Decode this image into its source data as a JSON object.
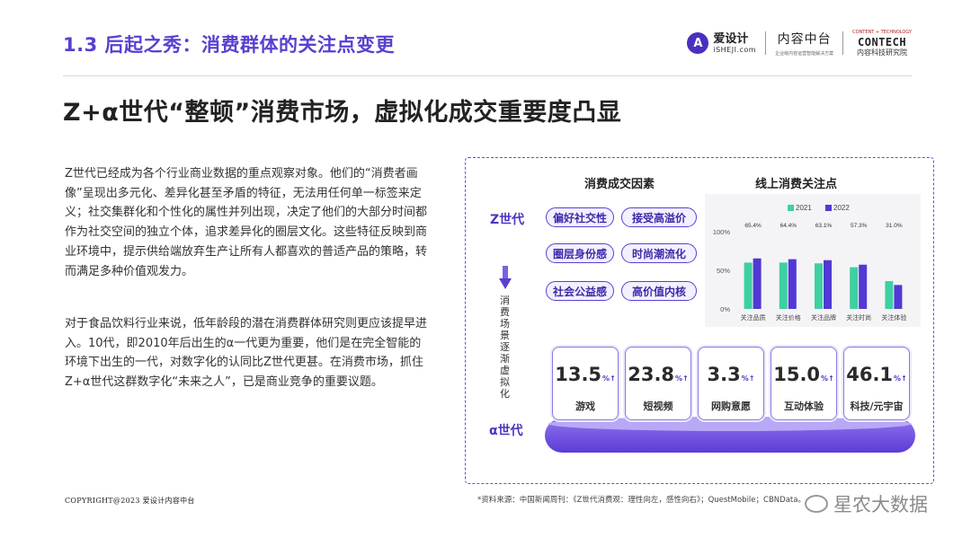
{
  "header": {
    "section_title": "1.3 后起之秀：消费群体的关注点变更",
    "logo_aisheji_main": "爱设计",
    "logo_aisheji_sub": "iSHEJI.com",
    "logo_aisheji_mark": "A",
    "logo_neirong_main": "内容中台",
    "logo_neirong_sub": "企业级内容运营智能解决方案",
    "logo_contech_top": "CONTENT + TECHNOLOGY",
    "logo_contech_main": "CONTECH",
    "logo_contech_sub": "内容科技研究院"
  },
  "main_title": "Z+α世代“整顿”消费市场，虚拟化成交重要度凸显",
  "paragraphs": [
    "Z世代已经成为各个行业商业数据的重点观察对象。他们的“消费者画像”呈现出多元化、差异化甚至矛盾的特征，无法用任何单一标签来定义；社交集群化和个性化的属性并列出现，决定了他们的大部分时间都作为社交空间的独立个体，追求差异化的圈层文化。这些特征反映到商业环境中，提示供给端放弃生产让所有人都喜欢的普适产品的策略，转而满足多种价值观发力。",
    "对于食品饮料行业来说，低年龄段的潜在消费群体研究则更应该提早进入。10代，即2010年后出生的α一代更为重要，他们是在完全智能的环境下出生的一代，对数字化的认同比Z世代更甚。在消费市场，抓住Z+α世代这群数字化“未来之人”，已是商业竞争的重要议题。"
  ],
  "infographic": {
    "heading_left": "消费成交因素",
    "heading_right": "线上消费关注点",
    "gen_z": "Z世代",
    "gen_alpha": "α世代",
    "vertical_text": "消费场景逐渐虚拟化",
    "tags": [
      "偏好社交性",
      "接受高溢价",
      "圈层身份感",
      "时尚潮流化",
      "社会公益感",
      "高价值内核"
    ],
    "colors": {
      "y2021": "#3ecfa3",
      "y2022": "#5238d4",
      "accent": "#5a3fd0"
    },
    "cards": [
      {
        "value": "13.5",
        "unit": "%↑",
        "label": "游戏"
      },
      {
        "value": "23.8",
        "unit": "%↑",
        "label": "短视频"
      },
      {
        "value": "3.3",
        "unit": "%↑",
        "label": "网购意愿"
      },
      {
        "value": "15.0",
        "unit": "%↑",
        "label": "互动体验"
      },
      {
        "value": "46.1",
        "unit": "%↑",
        "label": "科技/元宇宙"
      }
    ]
  },
  "chart_data": {
    "type": "bar",
    "categories": [
      "关注品质",
      "关注价格",
      "关注品牌",
      "关注时尚",
      "关注体验"
    ],
    "series": [
      {
        "name": "2021",
        "values": [
          60,
          60,
          59,
          54,
          36
        ]
      },
      {
        "name": "2022",
        "values": [
          65.4,
          64.4,
          63.1,
          57.3,
          31.0
        ]
      }
    ],
    "data_labels": [
      "65.4%",
      "64.4%",
      "63.1%",
      "57.3%",
      "31.0%"
    ],
    "ylim": [
      0,
      100
    ],
    "yticks": [
      "0%",
      "50%",
      "100%"
    ],
    "legend": "top",
    "grid": false
  },
  "footer": {
    "copyright": "COPYRIGHT@2023  爱设计内容中台",
    "source": "*资料来源：中国新闻周刊：《Z世代消费观：理性向左，感性向右》；QuestMobile；CBNData。",
    "watermark": "星农大数据"
  }
}
